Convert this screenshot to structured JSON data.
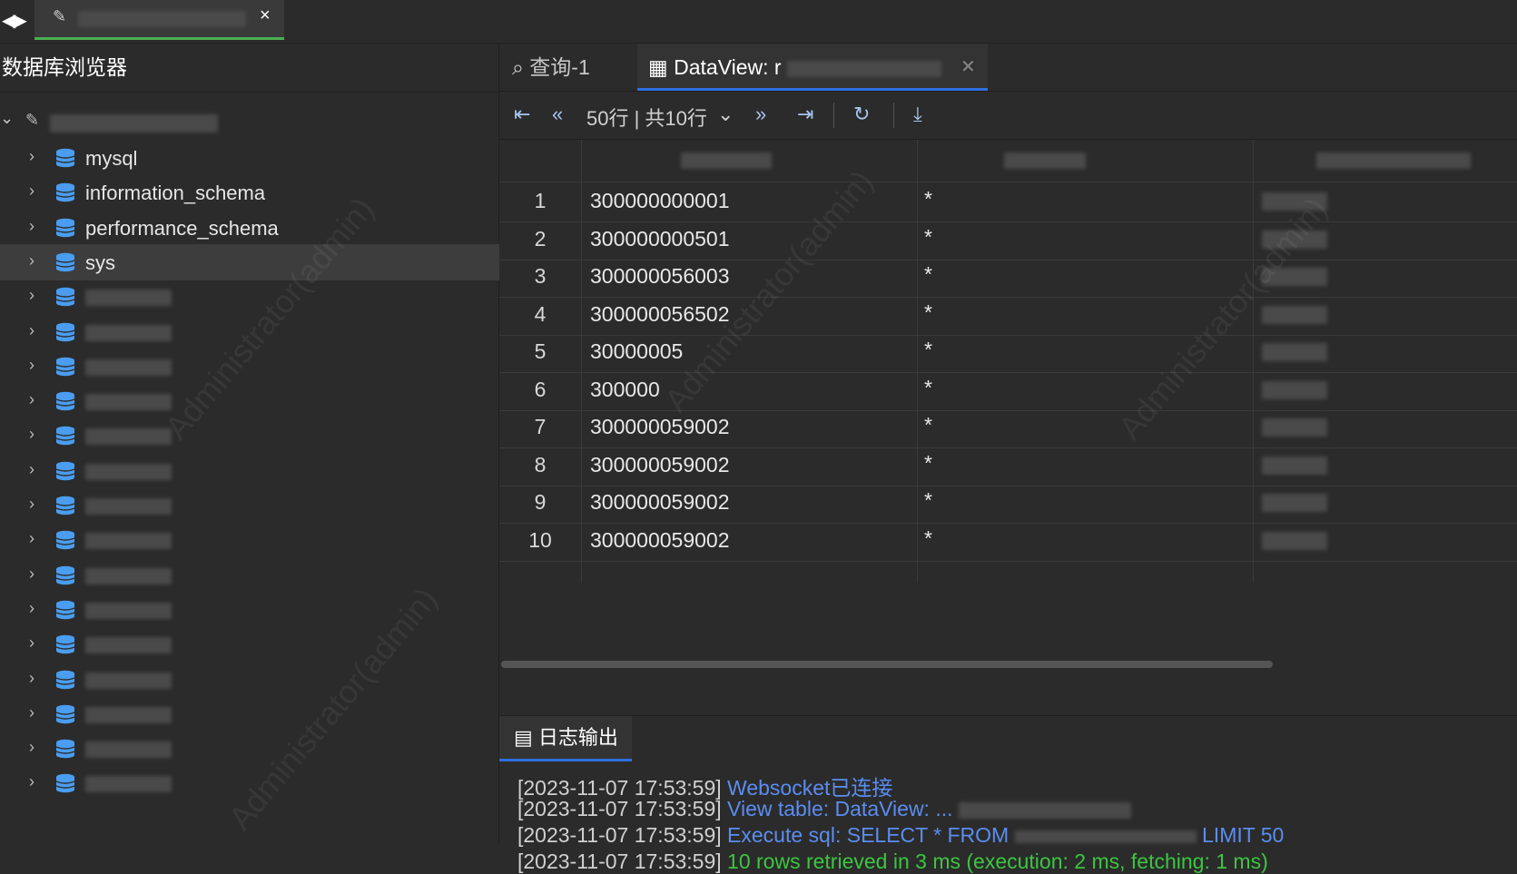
{
  "window_tab": {
    "close_label": "×"
  },
  "sidebar": {
    "title": "数据库浏览器",
    "items": [
      {
        "label": "mysql",
        "visible": true
      },
      {
        "label": "information_schema",
        "visible": true
      },
      {
        "label": "performance_schema",
        "visible": true
      },
      {
        "label": "sys",
        "visible": true,
        "selected": true
      },
      {
        "label": "",
        "visible": false
      },
      {
        "label": "",
        "visible": false
      },
      {
        "label": "",
        "visible": false
      },
      {
        "label": "",
        "visible": false
      },
      {
        "label": "",
        "visible": false
      },
      {
        "label": "",
        "visible": false
      },
      {
        "label": "",
        "visible": false
      },
      {
        "label": "",
        "visible": false
      },
      {
        "label": "",
        "visible": false
      },
      {
        "label": "",
        "visible": false
      },
      {
        "label": "",
        "visible": false
      },
      {
        "label": "",
        "visible": false
      },
      {
        "label": "",
        "visible": false
      },
      {
        "label": "",
        "visible": false
      },
      {
        "label": "",
        "visible": false
      }
    ]
  },
  "editor_tabs": [
    {
      "label": "查询-1",
      "icon": "search-icon"
    },
    {
      "label": "DataView: r",
      "icon": "table-icon",
      "active": true
    }
  ],
  "toolbar": {
    "pagination": "50行 | 共10行"
  },
  "grid": {
    "rows": [
      {
        "n": "1",
        "id": "300000000001",
        "c2": "*"
      },
      {
        "n": "2",
        "id": "300000000501",
        "c2": "*"
      },
      {
        "n": "3",
        "id": "300000056003",
        "c2": "*"
      },
      {
        "n": "4",
        "id": "300000056502",
        "c2": "*"
      },
      {
        "n": "5",
        "id": "30000005",
        "c2": "*"
      },
      {
        "n": "6",
        "id": "300000",
        "c2": "*"
      },
      {
        "n": "7",
        "id": "300000059002",
        "c2": "*"
      },
      {
        "n": "8",
        "id": "300000059002",
        "c2": "*"
      },
      {
        "n": "9",
        "id": "300000059002",
        "c2": "*"
      },
      {
        "n": "10",
        "id": "300000059002",
        "c2": "*"
      }
    ]
  },
  "log": {
    "tab_label": "日志输出",
    "lines": [
      {
        "ts": "[2023-11-07 17:53:59]",
        "msg": "Websocket已连接",
        "kind": "info"
      },
      {
        "ts": "[2023-11-07 17:53:59]",
        "msg": "View table: DataView: ...",
        "kind": "info"
      },
      {
        "ts": "[2023-11-07 17:53:59]",
        "msg": "Execute sql: SELECT * FROM",
        "msg2": "LIMIT 50",
        "kind": "info"
      },
      {
        "ts": "[2023-11-07 17:53:59]",
        "msg": "10 rows retrieved in 3 ms (execution: 2 ms, fetching: 1 ms)",
        "kind": "ok"
      }
    ]
  },
  "colors": {
    "accent": "#2f6fe0",
    "window_tab_accent": "#4caf50",
    "log_info": "#5b8df0",
    "log_ok": "#3cc640",
    "db_icon": "#4a9df0"
  }
}
